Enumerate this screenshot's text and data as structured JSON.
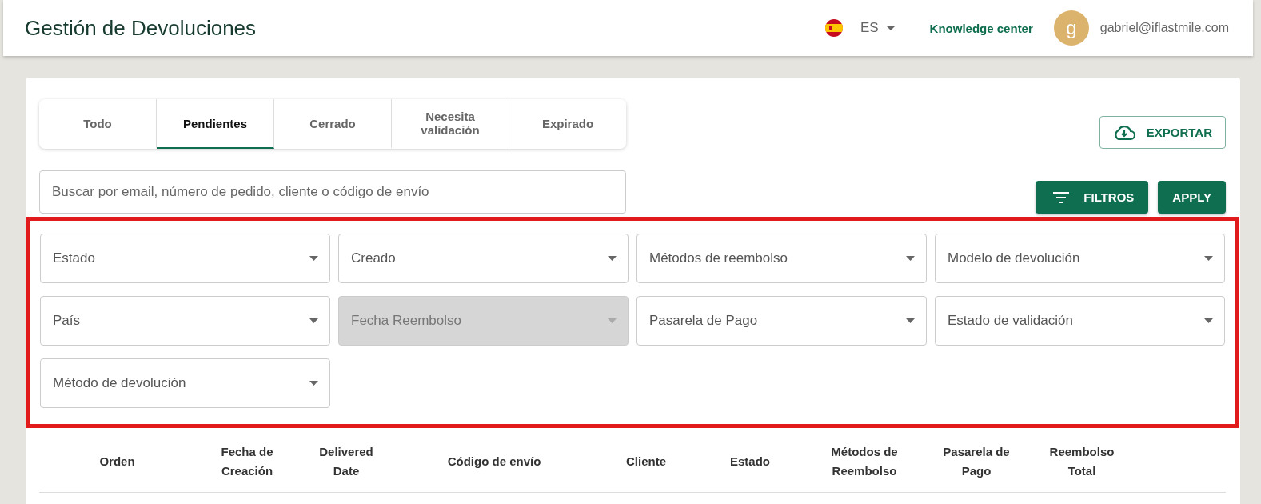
{
  "header": {
    "title": "Gestión de Devoluciones",
    "language": "ES",
    "knowledge_link": "Knowledge center",
    "avatar_letter": "g",
    "user_email": "gabriel@iflastmile.com"
  },
  "tabs": [
    {
      "label": "Todo",
      "selected": false
    },
    {
      "label": "Pendientes",
      "selected": true
    },
    {
      "label": "Cerrado",
      "selected": false
    },
    {
      "label": "Necesita validación",
      "selected": false
    },
    {
      "label": "Expirado",
      "selected": false
    }
  ],
  "export_button": "EXPORTAR",
  "search": {
    "placeholder": "Buscar por email, número de pedido, cliente o código de envío"
  },
  "filters_button": "FILTROS",
  "apply_button": "APPLY",
  "filters": [
    {
      "label": "Estado",
      "disabled": false
    },
    {
      "label": "Creado",
      "disabled": false
    },
    {
      "label": "Métodos de reembolso",
      "disabled": false
    },
    {
      "label": "Modelo de devolución",
      "disabled": false
    },
    {
      "label": "País",
      "disabled": false
    },
    {
      "label": "Fecha Reembolso",
      "disabled": true
    },
    {
      "label": "Pasarela de Pago",
      "disabled": false
    },
    {
      "label": "Estado de validación",
      "disabled": false
    },
    {
      "label": "Método de devolución",
      "disabled": false
    }
  ],
  "table": {
    "columns": [
      "Orden",
      "Fecha de Creación",
      "Delivered Date",
      "Código de envío",
      "Cliente",
      "Estado",
      "Métodos de Reembolso",
      "Pasarela de Pago",
      "Reembolso Total"
    ]
  }
}
